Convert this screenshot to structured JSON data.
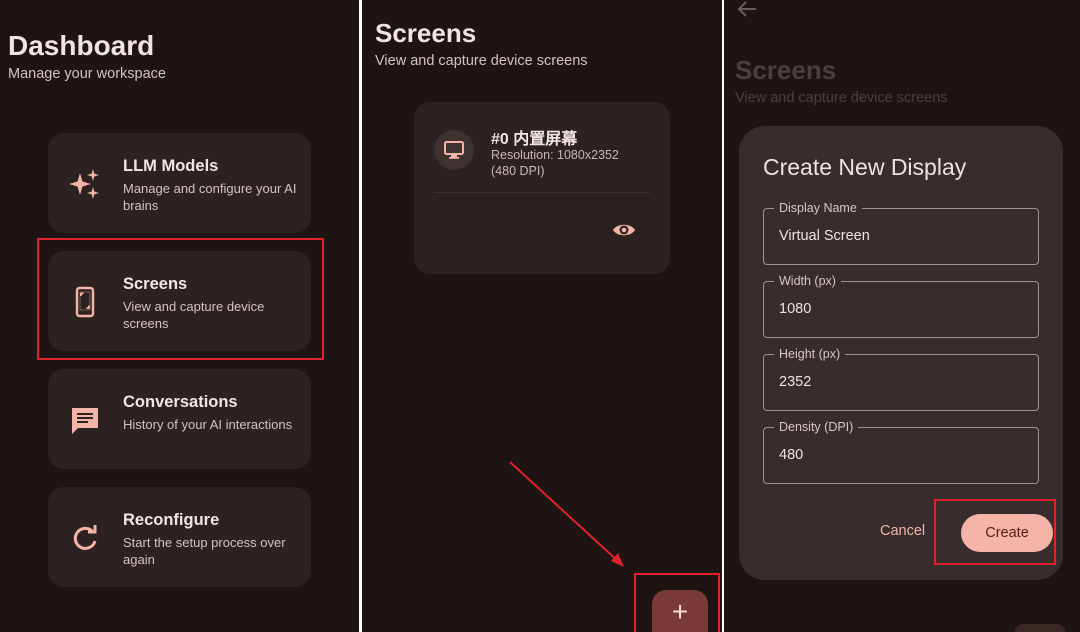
{
  "dashboard": {
    "title": "Dashboard",
    "subtitle": "Manage your workspace",
    "items": [
      {
        "icon": "sparkles-icon",
        "title": "LLM Models",
        "desc": "Manage and configure your AI brains"
      },
      {
        "icon": "phone-screen-icon",
        "title": "Screens",
        "desc": "View and capture device screens"
      },
      {
        "icon": "chat-icon",
        "title": "Conversations",
        "desc": "History of your AI interactions"
      },
      {
        "icon": "refresh-icon",
        "title": "Reconfigure",
        "desc": "Start the setup process over again"
      }
    ]
  },
  "screens": {
    "title": "Screens",
    "subtitle": "View and capture device screens",
    "display": {
      "name": "#0 内置屏幕",
      "resolution": "Resolution: 1080x2352 (480 DPI)",
      "icon": "monitor-icon",
      "action_icon": "eye-icon"
    },
    "fab_label": "+"
  },
  "dialog": {
    "bg_title": "Screens",
    "bg_subtitle": "View and capture device screens",
    "title": "Create New Display",
    "fields": [
      {
        "label": "Display Name",
        "value": "Virtual Screen"
      },
      {
        "label": "Width (px)",
        "value": "1080"
      },
      {
        "label": "Height (px)",
        "value": "2352"
      },
      {
        "label": "Density (DPI)",
        "value": "480"
      }
    ],
    "cancel_label": "Cancel",
    "create_label": "Create"
  },
  "colors": {
    "background": "#1d1413",
    "card": "#2b2221",
    "accent": "#f5b4a8",
    "highlight": "#e0222c",
    "fab": "#7a3a36"
  }
}
